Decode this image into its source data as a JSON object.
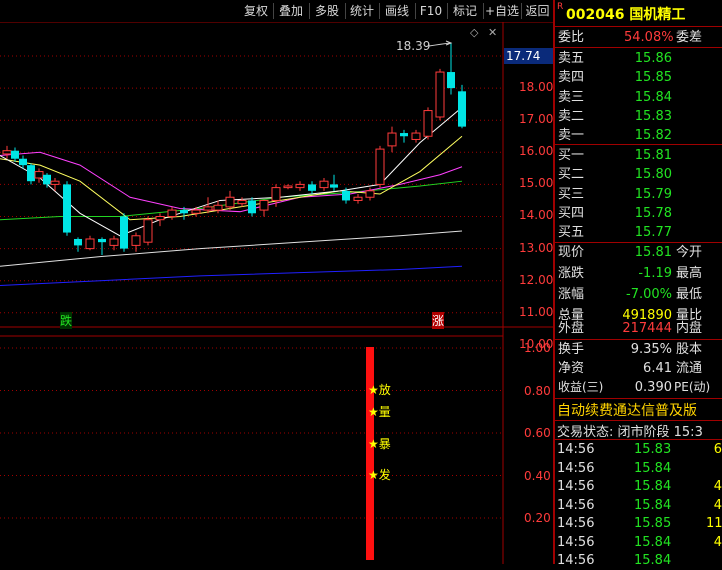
{
  "toolbar": {
    "fuquan": "复权",
    "diejia": "叠加",
    "duogu": "多股",
    "tongji": "统计",
    "huaxian": "画线",
    "f10": "F10",
    "biaoji": "标记",
    "zixuan": "+自选",
    "fanhui": "返回"
  },
  "chart": {
    "high_annotation": "18.39",
    "last_price_marker": "17.74",
    "price_axis": [
      "18.00",
      "17.00",
      "16.00",
      "15.00",
      "14.00",
      "13.00",
      "12.00",
      "11.00",
      "10.00"
    ],
    "indicator_axis": [
      "1.00",
      "0.80",
      "0.60",
      "0.40",
      "0.20"
    ],
    "bottom_label_down": "跌",
    "bottom_label_up": "涨",
    "signals": [
      {
        "star": "★",
        "text": "放"
      },
      {
        "star": "★",
        "text": "量"
      },
      {
        "star": "★",
        "text": "暴"
      },
      {
        "star": "★",
        "text": "发"
      }
    ],
    "colors": {
      "up": "#ff3b3b",
      "down": "#00e5e5",
      "ma5": "#ffffff",
      "ma10": "#ffff60",
      "ma20": "#ff40ff",
      "ma60": "#22d522",
      "ma120": "#e0e0e0",
      "ma250": "#2020ff"
    }
  },
  "stock": {
    "marker": "R",
    "code": "002046",
    "name": "国机精工"
  },
  "order_book": {
    "webi_label": "委比",
    "webi_value": "54.08%",
    "weicha_label": "委差",
    "asks": [
      {
        "label": "卖五",
        "price": "15.86"
      },
      {
        "label": "卖四",
        "price": "15.85"
      },
      {
        "label": "卖三",
        "price": "15.84"
      },
      {
        "label": "卖二",
        "price": "15.83"
      },
      {
        "label": "卖一",
        "price": "15.82"
      }
    ],
    "bids": [
      {
        "label": "买一",
        "price": "15.81"
      },
      {
        "label": "买二",
        "price": "15.80"
      },
      {
        "label": "买三",
        "price": "15.79"
      },
      {
        "label": "买四",
        "price": "15.78"
      },
      {
        "label": "买五",
        "price": "15.77"
      }
    ]
  },
  "quote": {
    "xianjia_label": "现价",
    "xianjia": "15.81",
    "jinkai_label": "今开",
    "zhangdie_label": "涨跌",
    "zhangdie": "-1.19",
    "zuigao_label": "最高",
    "zhangfu_label": "涨幅",
    "zhangfu": "-7.00%",
    "zuidi_label": "最低",
    "zongliang_label": "总量",
    "zongliang": "491890",
    "liangbi_label": "量比",
    "waipan_label": "外盘",
    "waipan": "217444",
    "neipan_label": "内盘",
    "huanshou_label": "换手",
    "huanshou": "9.35%",
    "guben_label": "股本",
    "jingzi_label": "净资",
    "jingzi": "6.41",
    "liutong_label": "流通",
    "shouyi_label": "收益(三)",
    "shouyi": "0.390",
    "pe_label": "PE(动)"
  },
  "banner": "自动续费通达信普及版",
  "trade_status": "交易状态: 闭市阶段 15:3",
  "ticks": [
    {
      "time": "14:56",
      "price": "15.83",
      "vol": "6"
    },
    {
      "time": "14:56",
      "price": "15.84",
      "vol": ""
    },
    {
      "time": "14:56",
      "price": "15.84",
      "vol": "4"
    },
    {
      "time": "14:56",
      "price": "15.84",
      "vol": "4"
    },
    {
      "time": "14:56",
      "price": "15.85",
      "vol": "11"
    },
    {
      "time": "14:56",
      "price": "15.84",
      "vol": "4"
    },
    {
      "time": "14:56",
      "price": "15.84",
      "vol": ""
    }
  ]
}
